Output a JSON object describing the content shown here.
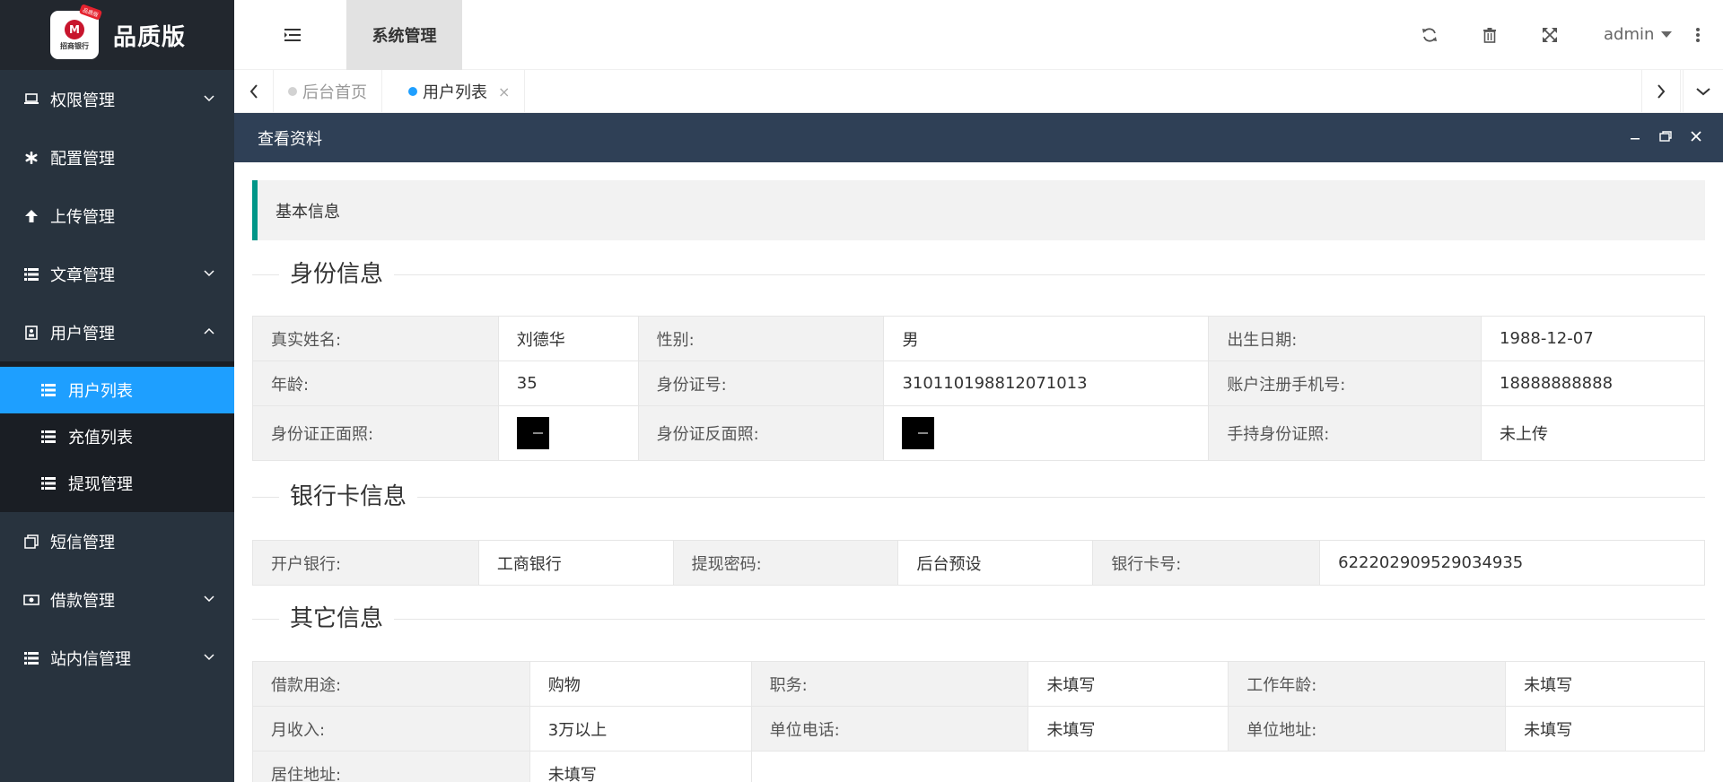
{
  "app": {
    "logo_text": "招商银行",
    "logo_badge": "品质版",
    "title": "品质版"
  },
  "sidebar": {
    "items": [
      {
        "label": "权限管理",
        "icon": "laptop-icon",
        "has_children": true
      },
      {
        "label": "配置管理",
        "icon": "asterisk-icon",
        "has_children": false
      },
      {
        "label": "上传管理",
        "icon": "arrow-up-icon",
        "has_children": false
      },
      {
        "label": "文章管理",
        "icon": "list-icon",
        "has_children": true
      },
      {
        "label": "用户管理",
        "icon": "user-card-icon",
        "has_children": true,
        "expanded": true
      },
      {
        "label": "短信管理",
        "icon": "copy-icon",
        "has_children": false
      },
      {
        "label": "借款管理",
        "icon": "money-icon",
        "has_children": true
      },
      {
        "label": "站内信管理",
        "icon": "list-icon",
        "has_children": true
      }
    ],
    "user_submenu": [
      {
        "label": "用户列表",
        "active": true
      },
      {
        "label": "充值列表",
        "active": false
      },
      {
        "label": "提现管理",
        "active": false
      }
    ]
  },
  "header": {
    "tab_label": "系统管理",
    "user": "admin"
  },
  "tabs": [
    {
      "label": "后台首页",
      "active": false,
      "dot_color": "#d2d2d2"
    },
    {
      "label": "用户列表",
      "active": true,
      "dot_color": "#1e9fff",
      "close": "×"
    }
  ],
  "dialog": {
    "title": "查看资料",
    "section_quote": "基本信息",
    "identity": {
      "title": "身份信息",
      "rows": [
        [
          "真实姓名:",
          "刘德华",
          "性别:",
          "男",
          "出生日期:",
          "1988-12-07"
        ],
        [
          "年龄:",
          "35",
          "身份证号:",
          "310110198812071013",
          "账户注册手机号:",
          "18888888888"
        ],
        [
          "身份证正面照:",
          "",
          "身份证反面照:",
          "",
          "手持身份证照:",
          "未上传"
        ]
      ]
    },
    "bank": {
      "title": "银行卡信息",
      "row": [
        "开户银行:",
        "工商银行",
        "提现密码:",
        "后台预设",
        "银行卡号:",
        "6222029095290349​35"
      ]
    },
    "other": {
      "title": "其它信息",
      "rows": [
        [
          "借款用途:",
          "购物",
          "职务:",
          "未填写",
          "工作年龄:",
          "未填写"
        ],
        [
          "月收入:",
          "3万以上",
          "单位电话:",
          "未填写",
          "单位地址:",
          "未填写"
        ],
        [
          "居住地址:",
          "未填写"
        ]
      ]
    }
  }
}
